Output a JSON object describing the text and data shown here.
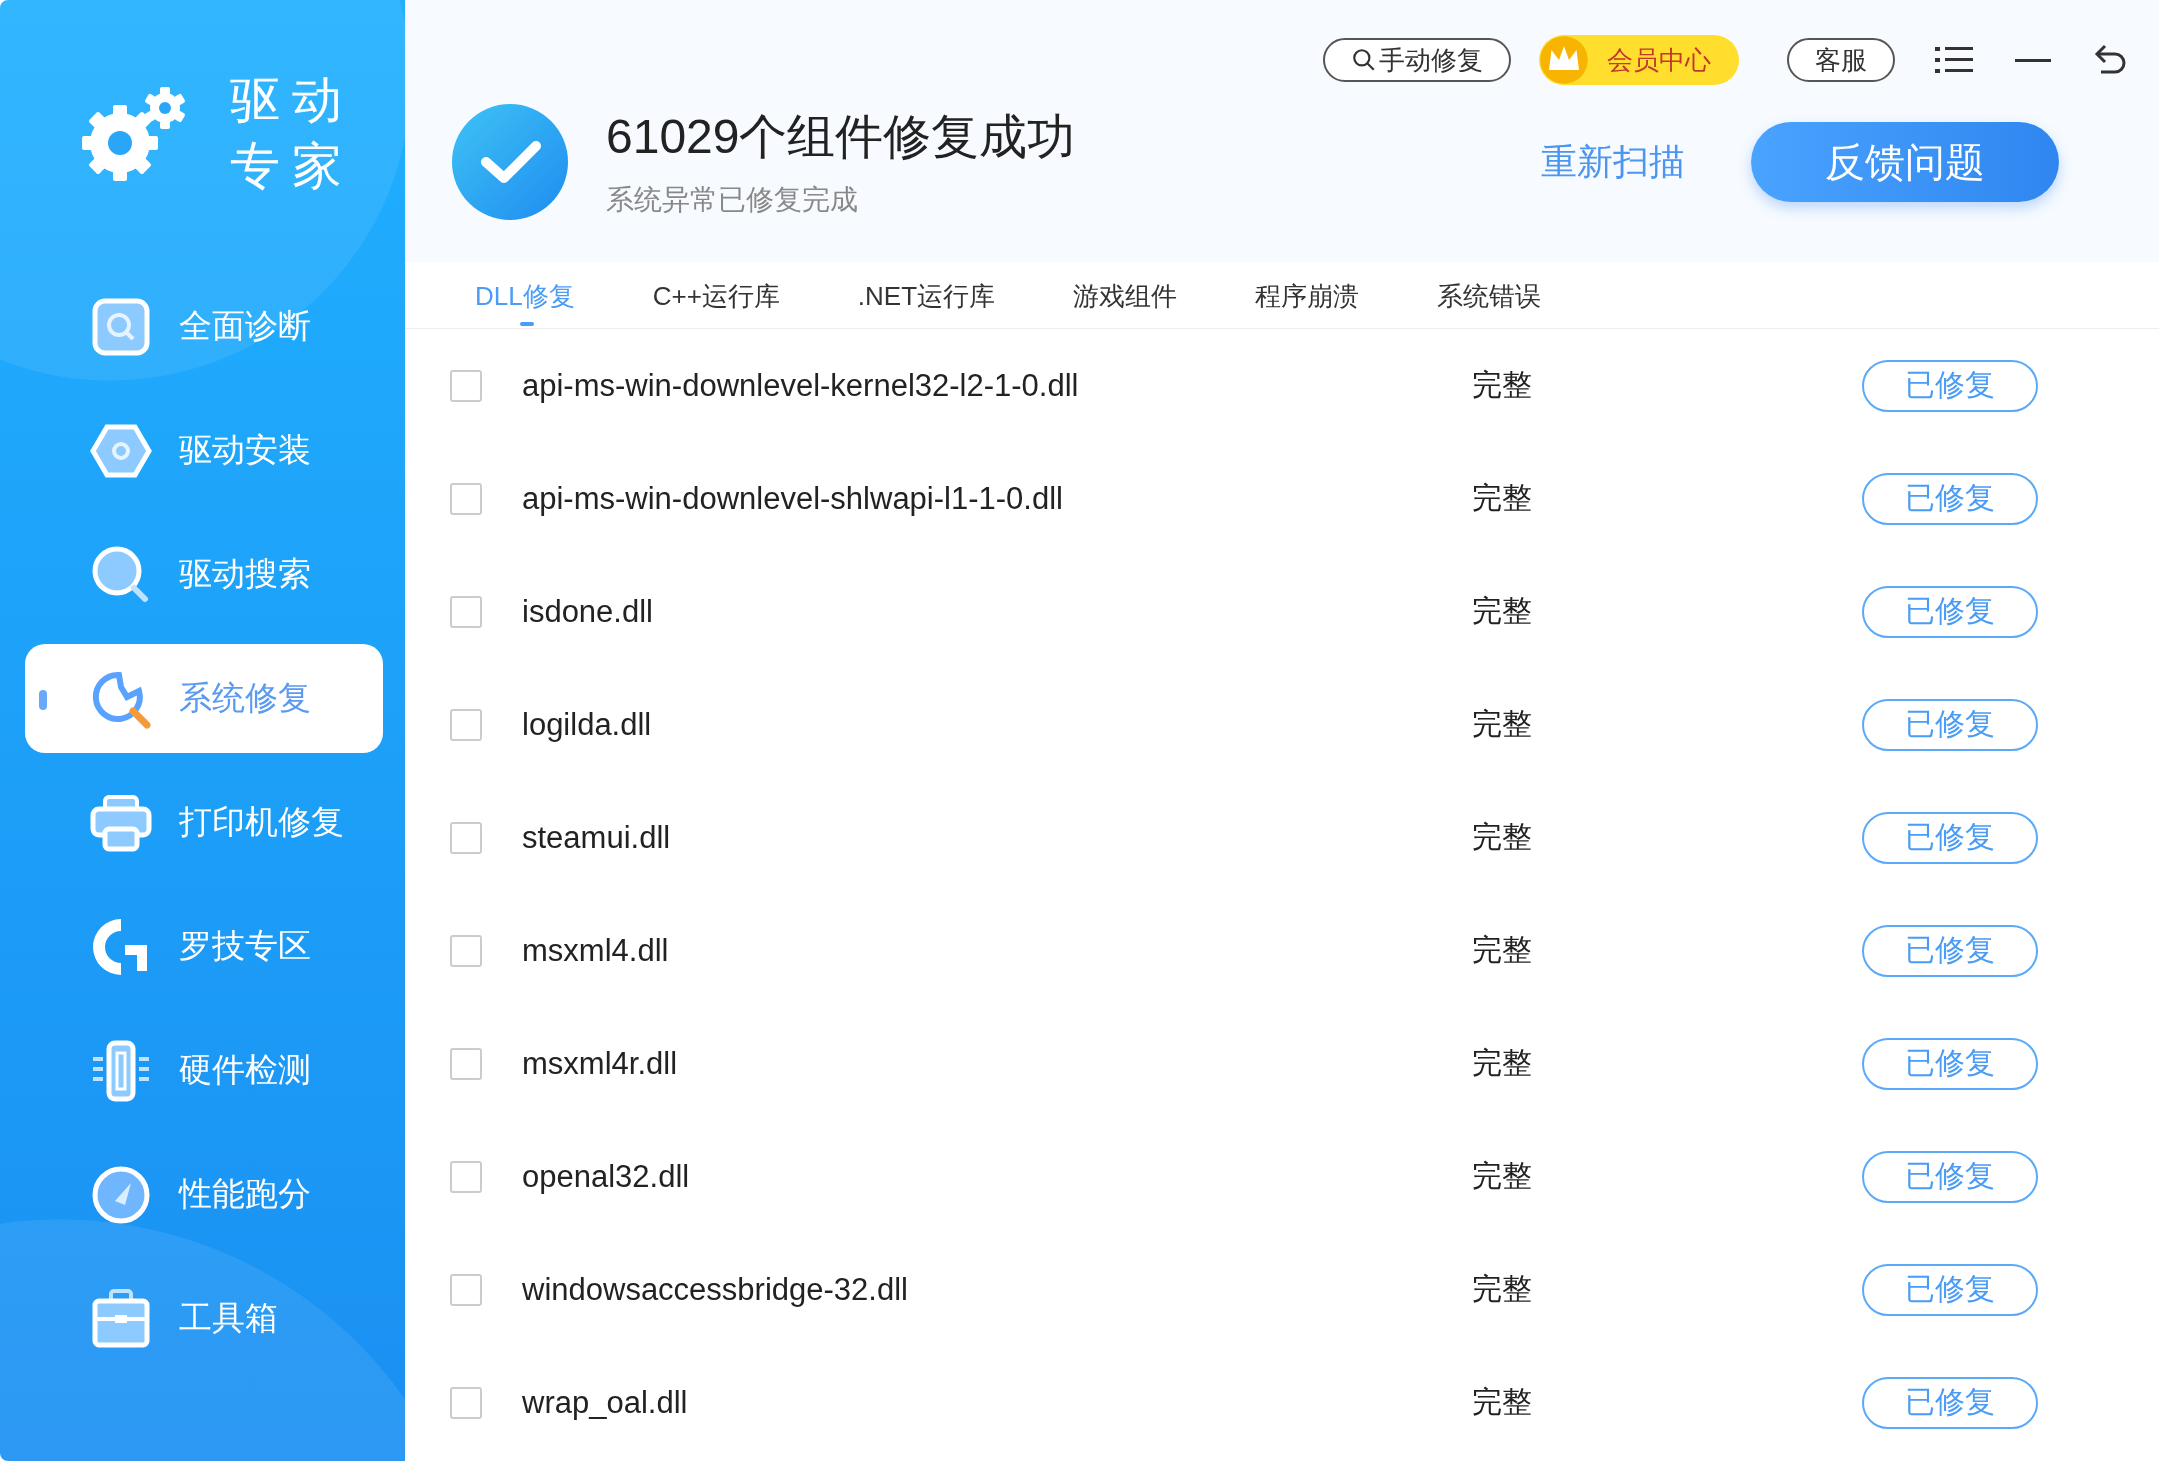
{
  "app": {
    "logo_line_1": "驱动",
    "logo_line_2": "专家"
  },
  "sidebar": {
    "items": [
      {
        "label": "全面诊断",
        "kind": "diagnose",
        "selected": false
      },
      {
        "label": "驱动安装",
        "kind": "install",
        "selected": false
      },
      {
        "label": "驱动搜索",
        "kind": "search",
        "selected": false
      },
      {
        "label": "系统修复",
        "kind": "repair",
        "selected": true
      },
      {
        "label": "打印机修复",
        "kind": "printer",
        "selected": false
      },
      {
        "label": "罗技专区",
        "kind": "logitech",
        "selected": false
      },
      {
        "label": "硬件检测",
        "kind": "hardware",
        "selected": false
      },
      {
        "label": "性能跑分",
        "kind": "gauge",
        "selected": false
      },
      {
        "label": "工具箱",
        "kind": "toolbox",
        "selected": false
      }
    ]
  },
  "top_bar": {
    "manual_repair": "手动修复",
    "member_center": "会员中心",
    "support": "客服"
  },
  "result": {
    "title": "61029个组件修复成功",
    "subtitle": "系统异常已修复完成",
    "rescan": "重新扫描",
    "feedback": "反馈问题"
  },
  "tabs": [
    {
      "label": "DLL修复",
      "selected": true
    },
    {
      "label": "C++运行库",
      "selected": false
    },
    {
      "label": ".NET运行库",
      "selected": false
    },
    {
      "label": "游戏组件",
      "selected": false
    },
    {
      "label": "程序崩溃",
      "selected": false
    },
    {
      "label": "系统错误",
      "selected": false
    }
  ],
  "rows": [
    {
      "name": "api-ms-win-downlevel-kernel32-l2-1-0.dll",
      "status": "完整",
      "action": "已修复",
      "checked": false
    },
    {
      "name": "api-ms-win-downlevel-shlwapi-l1-1-0.dll",
      "status": "完整",
      "action": "已修复",
      "checked": false
    },
    {
      "name": "isdone.dll",
      "status": "完整",
      "action": "已修复",
      "checked": false
    },
    {
      "name": "logilda.dll",
      "status": "完整",
      "action": "已修复",
      "checked": false
    },
    {
      "name": "steamui.dll",
      "status": "完整",
      "action": "已修复",
      "checked": false
    },
    {
      "name": "msxml4.dll",
      "status": "完整",
      "action": "已修复",
      "checked": false
    },
    {
      "name": "msxml4r.dll",
      "status": "完整",
      "action": "已修复",
      "checked": false
    },
    {
      "name": "openal32.dll",
      "status": "完整",
      "action": "已修复",
      "checked": false
    },
    {
      "name": "windowsaccessbridge-32.dll",
      "status": "完整",
      "action": "已修复",
      "checked": false
    },
    {
      "name": "wrap_oal.dll",
      "status": "完整",
      "action": "已修复",
      "checked": false
    }
  ]
}
